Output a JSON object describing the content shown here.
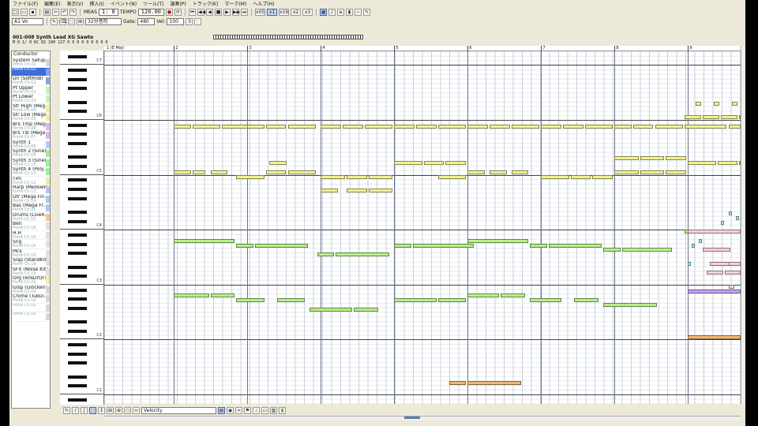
{
  "menu": [
    "ファイル(F)",
    "編集(E)",
    "表示(V)",
    "挿入(I)",
    "イベント(N)",
    "ツール(T)",
    "演奏(P)",
    "トラック(K)",
    "マーク(M)",
    "ヘルプ(H)"
  ],
  "toolbar": {
    "measure_label": "MEAS",
    "position": "1:  0",
    "tempo_label": "TEMPO",
    "tempo": "120.00",
    "quantize_opts": [
      "x05",
      "x1",
      "x16",
      "x2",
      "x3"
    ],
    "track_select": "A1 Vo",
    "note_length": "32分音符",
    "gate_label": "Gate:",
    "gate": "480",
    "vel_label": "Vel:",
    "vel": "100"
  },
  "track_info": {
    "name": "001-008 Synth Lead XG Sawto",
    "header": "M  1 VOL EXP PAN P.BEND MOD HOLD CUT RESO REV CHO DLY",
    "values": "M  0  1/  0  KC  82   100 127  0  0  0  0  0  0  0  0  0"
  },
  "tracks": [
    {
      "name": "System Setup",
      "port": "PortA Ch.01"
    },
    {
      "name": "",
      "port": "PortA Ch.01"
    },
    {
      "name": "Un (SoftRnB)",
      "port": "PortA Ch.02"
    },
    {
      "name": "Pt Upper",
      "port": "PortA Ch.02"
    },
    {
      "name": "Pt Lower",
      "port": "PortA Ch.03"
    },
    {
      "name": "Str High (Meg...",
      "port": "PortA Ch.04"
    },
    {
      "name": "Str Low (Mega...",
      "port": "PortA Ch.05"
    },
    {
      "name": "Brs Tmp (Meg...",
      "port": "PortA Ch.06"
    },
    {
      "name": "Brs Tlb (Mega...",
      "port": "PortA Ch.07"
    },
    {
      "name": "Synth 1",
      "port": "PortA Ch.08"
    },
    {
      "name": "Synth 2 (Sine)...",
      "port": "PortA Ch.09"
    },
    {
      "name": "Synth 3 (Sine)...",
      "port": "PortA Ch.10"
    },
    {
      "name": "Synth 4 (Poly...",
      "port": "PortA Ch.11"
    },
    {
      "name": "Tim",
      "port": "PortA Ch.12"
    },
    {
      "name": "Harp (MellowH...",
      "port": "PortA Ch.13"
    },
    {
      "name": "Utr (Mega Fin...",
      "port": "PortA Ch.14"
    },
    {
      "name": "Bas (Mega Fr...",
      "port": "PortA Ch.15"
    },
    {
      "name": "Drums (LiveR...",
      "port": "PortA Ch.10"
    },
    {
      "name": "Bell",
      "port": "PortA Ch.16"
    },
    {
      "name": "H.H",
      "port": "PortA Ch.16"
    },
    {
      "name": "Sng",
      "port": "PortA Ch.16"
    },
    {
      "name": "Mcs",
      "port": "PortA Ch.16"
    },
    {
      "name": "Slap (StandKit)",
      "port": "PortA Ch.16"
    },
    {
      "name": "SFX (Noise Kit)",
      "port": "PortA Ch.16"
    },
    {
      "name": "Org (60sDrOrT)",
      "port": "PortA Ch.01"
    },
    {
      "name": "Glsp (Glocken)",
      "port": "PortA Ch.04"
    },
    {
      "name": "Chime (Tubul...",
      "port": "PortA Ch.16"
    },
    {
      "name": "",
      "port": "PortA Ch.16"
    },
    {
      "name": "",
      "port": "PortA Ch.16"
    }
  ],
  "conductor_label": "Conductor",
  "ruler": {
    "first_label": "1 (E Maj)",
    "bars": [
      "2",
      "3",
      "4",
      "5",
      "6",
      "7",
      "8",
      "9"
    ]
  },
  "octaves": [
    "C7",
    "C6",
    "C5",
    "C4",
    "C3",
    "C2",
    "C1"
  ],
  "bottom": {
    "controller": "Velocity"
  },
  "colors": {
    "lead": "#f2f291",
    "mid": "#b8ef8a",
    "low": "#f0b870",
    "pink": "#f6d0d6",
    "purple": "#c8a0f0",
    "cyan": "#a8f0ea"
  },
  "notes": [
    {
      "m": 2.0,
      "len": 0.25,
      "p": 82,
      "c": "lead"
    },
    {
      "m": 2.25,
      "len": 0.4,
      "p": 82,
      "c": "lead"
    },
    {
      "m": 2.65,
      "len": 0.4,
      "p": 82,
      "c": "lead"
    },
    {
      "m": 3.0,
      "len": 0.25,
      "p": 82,
      "c": "lead"
    },
    {
      "m": 3.25,
      "len": 0.3,
      "p": 82,
      "c": "lead"
    },
    {
      "m": 3.55,
      "len": 0.4,
      "p": 82,
      "c": "lead"
    },
    {
      "m": 4.0,
      "len": 0.3,
      "p": 82,
      "c": "lead"
    },
    {
      "m": 4.3,
      "len": 0.3,
      "p": 82,
      "c": "lead"
    },
    {
      "m": 4.6,
      "len": 0.4,
      "p": 82,
      "c": "lead"
    },
    {
      "m": 5.0,
      "len": 0.3,
      "p": 82,
      "c": "lead"
    },
    {
      "m": 5.3,
      "len": 0.3,
      "p": 82,
      "c": "lead"
    },
    {
      "m": 5.6,
      "len": 0.4,
      "p": 82,
      "c": "lead"
    },
    {
      "m": 6.0,
      "len": 0.3,
      "p": 82,
      "c": "lead"
    },
    {
      "m": 6.3,
      "len": 0.3,
      "p": 82,
      "c": "lead"
    },
    {
      "m": 6.6,
      "len": 0.4,
      "p": 82,
      "c": "lead"
    },
    {
      "m": 7.0,
      "len": 0.3,
      "p": 82,
      "c": "lead"
    },
    {
      "m": 7.3,
      "len": 0.3,
      "p": 82,
      "c": "lead"
    },
    {
      "m": 7.6,
      "len": 0.4,
      "p": 82,
      "c": "lead"
    },
    {
      "m": 8.0,
      "len": 0.25,
      "p": 82,
      "c": "lead"
    },
    {
      "m": 8.25,
      "len": 0.3,
      "p": 82,
      "c": "lead"
    },
    {
      "m": 8.55,
      "len": 0.4,
      "p": 82,
      "c": "lead"
    },
    {
      "m": 8.95,
      "len": 0.6,
      "p": 82,
      "c": "lead"
    },
    {
      "m": 9.55,
      "len": 0.45,
      "p": 82,
      "c": "lead"
    },
    {
      "m": 8.95,
      "len": 0.25,
      "p": 84,
      "c": "lead"
    },
    {
      "m": 9.2,
      "len": 0.25,
      "p": 84,
      "c": "lead"
    },
    {
      "m": 9.45,
      "len": 0.25,
      "p": 84,
      "c": "lead"
    },
    {
      "m": 9.7,
      "len": 0.25,
      "p": 84,
      "c": "lead"
    },
    {
      "m": 9.1,
      "len": 0.1,
      "p": 87,
      "c": "lead"
    },
    {
      "m": 9.35,
      "len": 0.1,
      "p": 87,
      "c": "lead"
    },
    {
      "m": 9.6,
      "len": 0.1,
      "p": 87,
      "c": "lead"
    },
    {
      "m": 9.85,
      "len": 0.1,
      "p": 87,
      "c": "lead"
    },
    {
      "m": 2.0,
      "len": 0.25,
      "p": 72,
      "c": "lead"
    },
    {
      "m": 2.25,
      "len": 0.2,
      "p": 72,
      "c": "lead"
    },
    {
      "m": 2.5,
      "len": 0.25,
      "p": 72,
      "c": "lead"
    },
    {
      "m": 2.85,
      "len": 0.4,
      "p": 71,
      "c": "lead"
    },
    {
      "m": 3.25,
      "len": 0.3,
      "p": 72,
      "c": "lead"
    },
    {
      "m": 3.55,
      "len": 0.4,
      "p": 72,
      "c": "lead"
    },
    {
      "m": 3.3,
      "len": 0.25,
      "p": 74,
      "c": "lead"
    },
    {
      "m": 4.0,
      "len": 0.35,
      "p": 71,
      "c": "lead"
    },
    {
      "m": 4.35,
      "len": 0.3,
      "p": 71,
      "c": "lead"
    },
    {
      "m": 4.65,
      "len": 0.35,
      "p": 71,
      "c": "lead"
    },
    {
      "m": 4.0,
      "len": 0.25,
      "p": 68,
      "c": "lead"
    },
    {
      "m": 4.35,
      "len": 0.3,
      "p": 68,
      "c": "lead"
    },
    {
      "m": 4.65,
      "len": 0.35,
      "p": 68,
      "c": "lead"
    },
    {
      "m": 5.0,
      "len": 0.4,
      "p": 74,
      "c": "lead"
    },
    {
      "m": 5.4,
      "len": 0.3,
      "p": 74,
      "c": "lead"
    },
    {
      "m": 5.7,
      "len": 0.3,
      "p": 74,
      "c": "lead"
    },
    {
      "m": 5.6,
      "len": 0.4,
      "p": 71,
      "c": "lead"
    },
    {
      "m": 6.0,
      "len": 0.25,
      "p": 72,
      "c": "lead"
    },
    {
      "m": 6.3,
      "len": 0.25,
      "p": 72,
      "c": "lead"
    },
    {
      "m": 6.6,
      "len": 0.25,
      "p": 72,
      "c": "lead"
    },
    {
      "m": 7.0,
      "len": 0.4,
      "p": 71,
      "c": "lead"
    },
    {
      "m": 7.4,
      "len": 0.3,
      "p": 71,
      "c": "lead"
    },
    {
      "m": 7.7,
      "len": 0.3,
      "p": 71,
      "c": "lead"
    },
    {
      "m": 8.0,
      "len": 0.35,
      "p": 75,
      "c": "lead"
    },
    {
      "m": 8.35,
      "len": 0.35,
      "p": 75,
      "c": "lead"
    },
    {
      "m": 8.7,
      "len": 0.3,
      "p": 75,
      "c": "lead"
    },
    {
      "m": 8.0,
      "len": 0.35,
      "p": 72,
      "c": "lead"
    },
    {
      "m": 8.35,
      "len": 0.35,
      "p": 72,
      "c": "lead"
    },
    {
      "m": 8.7,
      "len": 0.3,
      "p": 72,
      "c": "lead"
    },
    {
      "m": 9.0,
      "len": 0.4,
      "p": 74,
      "c": "lead"
    },
    {
      "m": 9.4,
      "len": 0.3,
      "p": 74,
      "c": "lead"
    },
    {
      "m": 9.7,
      "len": 0.3,
      "p": 74,
      "c": "lead"
    },
    {
      "m": 2.0,
      "len": 0.85,
      "p": 57,
      "c": "mid"
    },
    {
      "m": 2.85,
      "len": 0.25,
      "p": 56,
      "c": "mid"
    },
    {
      "m": 3.1,
      "len": 0.75,
      "p": 56,
      "c": "mid"
    },
    {
      "m": 3.95,
      "len": 0.25,
      "p": 54,
      "c": "mid"
    },
    {
      "m": 4.2,
      "len": 0.75,
      "p": 54,
      "c": "mid"
    },
    {
      "m": 5.0,
      "len": 0.25,
      "p": 56,
      "c": "mid"
    },
    {
      "m": 5.25,
      "len": 0.85,
      "p": 56,
      "c": "mid"
    },
    {
      "m": 6.0,
      "len": 0.85,
      "p": 57,
      "c": "mid"
    },
    {
      "m": 6.85,
      "len": 0.25,
      "p": 56,
      "c": "mid"
    },
    {
      "m": 7.1,
      "len": 0.75,
      "p": 56,
      "c": "mid"
    },
    {
      "m": 7.85,
      "len": 0.25,
      "p": 55,
      "c": "mid"
    },
    {
      "m": 8.1,
      "len": 0.7,
      "p": 55,
      "c": "mid"
    },
    {
      "m": 8.95,
      "len": 0.15,
      "p": 59,
      "c": "mid"
    },
    {
      "m": 2.0,
      "len": 0.5,
      "p": 45,
      "c": "mid"
    },
    {
      "m": 2.5,
      "len": 0.35,
      "p": 45,
      "c": "mid"
    },
    {
      "m": 2.85,
      "len": 0.4,
      "p": 44,
      "c": "mid"
    },
    {
      "m": 3.4,
      "len": 0.4,
      "p": 44,
      "c": "mid"
    },
    {
      "m": 3.85,
      "len": 0.6,
      "p": 42,
      "c": "mid"
    },
    {
      "m": 4.45,
      "len": 0.35,
      "p": 42,
      "c": "mid"
    },
    {
      "m": 5.0,
      "len": 0.6,
      "p": 44,
      "c": "mid"
    },
    {
      "m": 5.6,
      "len": 0.4,
      "p": 44,
      "c": "mid"
    },
    {
      "m": 6.0,
      "len": 0.45,
      "p": 45,
      "c": "mid"
    },
    {
      "m": 6.45,
      "len": 0.35,
      "p": 45,
      "c": "mid"
    },
    {
      "m": 6.85,
      "len": 0.45,
      "p": 44,
      "c": "mid"
    },
    {
      "m": 7.45,
      "len": 0.35,
      "p": 44,
      "c": "mid"
    },
    {
      "m": 7.85,
      "len": 0.75,
      "p": 43,
      "c": "mid"
    },
    {
      "m": 9.0,
      "len": 1.0,
      "p": 59,
      "c": "pink"
    },
    {
      "m": 9.2,
      "len": 0.4,
      "p": 55,
      "c": "pink"
    },
    {
      "m": 9.3,
      "len": 0.3,
      "p": 52,
      "c": "pink"
    },
    {
      "m": 9.55,
      "len": 0.4,
      "p": 52,
      "c": "pink"
    },
    {
      "m": 9.25,
      "len": 0.25,
      "p": 50,
      "c": "pink"
    },
    {
      "m": 9.5,
      "len": 0.45,
      "p": 50,
      "c": "pink"
    },
    {
      "m": 9.55,
      "len": 0.1,
      "p": 47,
      "c": "pink"
    },
    {
      "m": 9.5,
      "len": 0.1,
      "p": 46,
      "c": "pink"
    },
    {
      "m": 9.0,
      "len": 0.85,
      "p": 46,
      "c": "purple"
    },
    {
      "m": 9.05,
      "len": 0.06,
      "p": 56,
      "c": "cyan"
    },
    {
      "m": 9.15,
      "len": 0.06,
      "p": 57,
      "c": "cyan"
    },
    {
      "m": 9.45,
      "len": 0.06,
      "p": 61,
      "c": "cyan"
    },
    {
      "m": 9.55,
      "len": 0.06,
      "p": 63,
      "c": "cyan"
    },
    {
      "m": 9.65,
      "len": 0.06,
      "p": 62,
      "c": "cyan"
    },
    {
      "m": 9.0,
      "len": 0.06,
      "p": 52,
      "c": "cyan"
    },
    {
      "m": 9.0,
      "len": 1.0,
      "p": 36,
      "c": "low"
    },
    {
      "m": 5.75,
      "len": 0.25,
      "p": 26,
      "c": "low"
    },
    {
      "m": 6.0,
      "len": 0.75,
      "p": 26,
      "c": "low"
    },
    {
      "m": 5.75,
      "len": 0.25,
      "p": 21,
      "c": "low"
    },
    {
      "m": 6.0,
      "len": 0.75,
      "p": 21,
      "c": "low"
    }
  ]
}
